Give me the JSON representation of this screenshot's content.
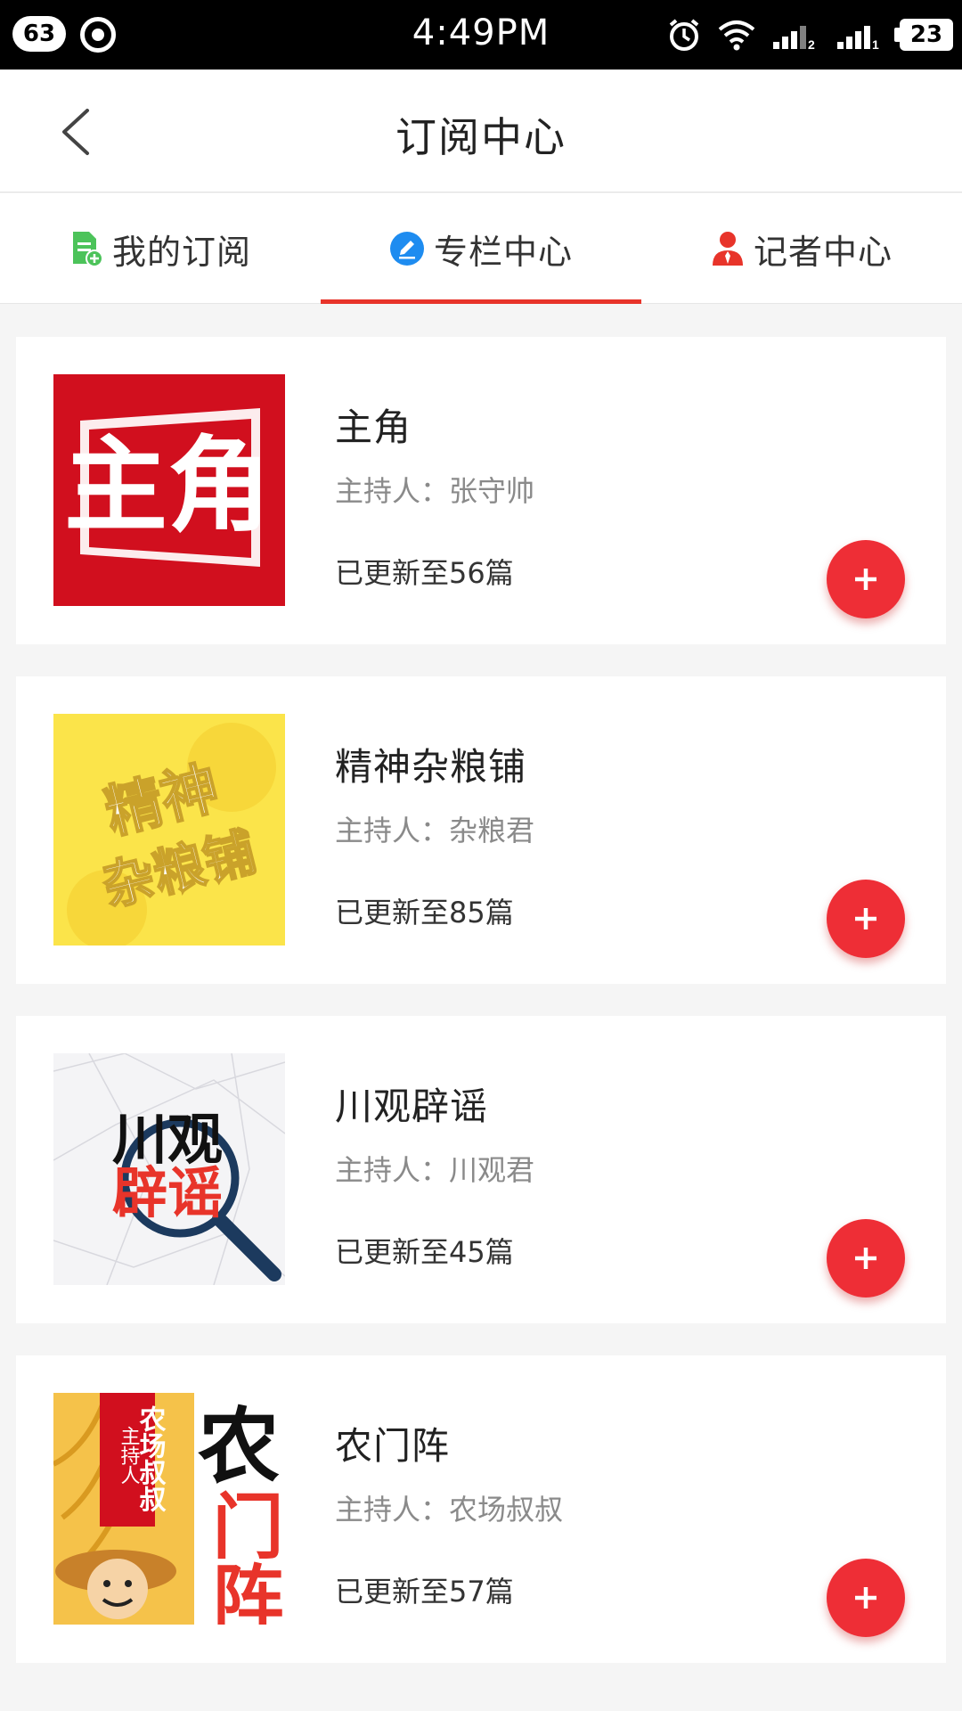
{
  "status_bar": {
    "notification_count": "63",
    "time": "4:49PM",
    "battery": "23",
    "icons": [
      "record-icon",
      "alarm-icon",
      "wifi-icon",
      "signal-sim2-icon",
      "signal-sim1-icon",
      "battery-icon"
    ]
  },
  "header": {
    "title": "订阅中心",
    "back_icon": "chevron-left-icon"
  },
  "tabs": [
    {
      "label": "我的订阅",
      "icon": "document-add-icon",
      "icon_color": "#4cc35a",
      "active": false
    },
    {
      "label": "专栏中心",
      "icon": "pen-circle-icon",
      "icon_color": "#1e8cf0",
      "active": true
    },
    {
      "label": "记者中心",
      "icon": "person-icon",
      "icon_color": "#e8342a",
      "active": false
    }
  ],
  "accent_color": "#e8342a",
  "columns": [
    {
      "title": "主角",
      "host": "主持人：张守帅",
      "count": "已更新至56篇",
      "thumb_text": [
        "主角"
      ],
      "thumb_bg": "#d10f1e"
    },
    {
      "title": "精神杂粮铺",
      "host": "主持人：杂粮君",
      "count": "已更新至85篇",
      "thumb_text": [
        "精神",
        "杂粮铺"
      ],
      "thumb_bg": "#fbe44a"
    },
    {
      "title": "川观辟谣",
      "host": "主持人：川观君",
      "count": "已更新至45篇",
      "thumb_text": [
        "川观",
        "辟谣"
      ],
      "thumb_bg": "#f4f4f6"
    },
    {
      "title": "农门阵",
      "host": "主持人：农场叔叔",
      "count": "已更新至57篇",
      "thumb_text": [
        "农",
        "门阵",
        "农场叔叔",
        "主持人"
      ],
      "thumb_bg": "#f2b235"
    }
  ]
}
